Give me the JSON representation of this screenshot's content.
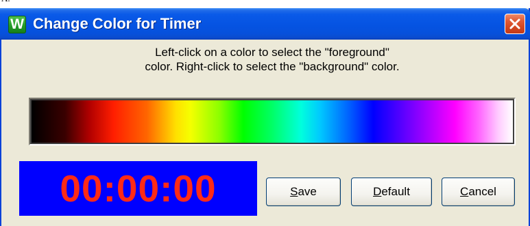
{
  "top_fragment": "A.",
  "window": {
    "title": "Change Color for Timer",
    "app_icon_letter": "W"
  },
  "instructions": {
    "line1": "Left-click on a color to select the \"foreground\"",
    "line2": "color. Right-click to select the \"background\" color."
  },
  "timer": {
    "value": "00:00:00",
    "foreground_color": "#ff2a16",
    "background_color": "#0000ff"
  },
  "buttons": {
    "save": {
      "mnemonic": "S",
      "rest": "ave"
    },
    "default": {
      "mnemonic": "D",
      "rest": "efault"
    },
    "cancel": {
      "mnemonic": "C",
      "rest": "ancel"
    }
  },
  "icons": {
    "app": "app-w-icon",
    "close": "close-x-icon"
  },
  "colors": {
    "titlebar": "#0553e2",
    "dialog_background": "#ece9d8",
    "close_button": "#d2461f"
  }
}
